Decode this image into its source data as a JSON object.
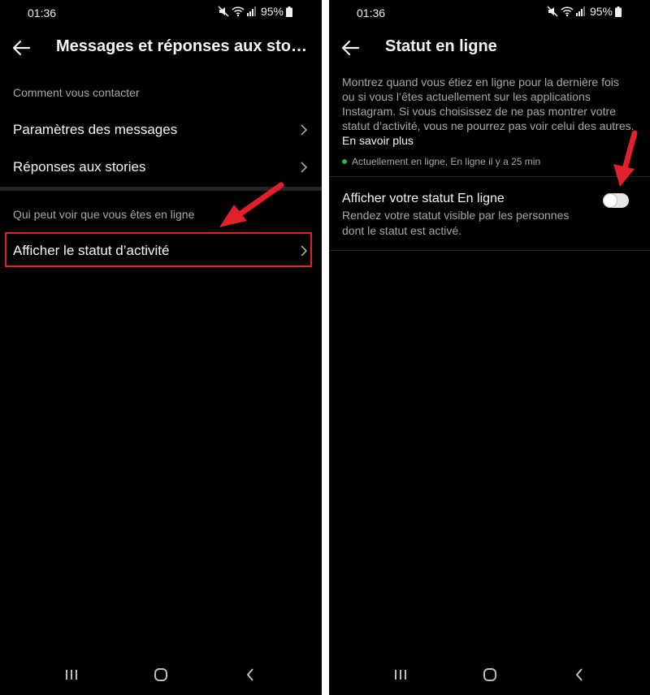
{
  "colors": {
    "background": "#000000",
    "text_primary": "#f5f5f5",
    "text_secondary": "#a8a8a8",
    "divider": "#262626",
    "highlight_red": "#e0202b",
    "online_green": "#2bb24c"
  },
  "left": {
    "status_bar": {
      "time": "01:36",
      "battery": "95%"
    },
    "header": {
      "title": "Messages et réponses aux sto…"
    },
    "section1": {
      "label": "Comment vous contacter",
      "items": [
        {
          "label": "Paramètres des messages",
          "icon": "chevron-right-icon"
        },
        {
          "label": "Réponses aux stories",
          "icon": "chevron-right-icon"
        }
      ]
    },
    "section2": {
      "label": "Qui peut voir que vous êtes en ligne",
      "items": [
        {
          "label": "Afficher le statut d’activité",
          "icon": "chevron-right-icon",
          "highlighted": true
        }
      ]
    }
  },
  "right": {
    "status_bar": {
      "time": "01:36",
      "battery": "95%"
    },
    "header": {
      "title": "Statut en ligne"
    },
    "description": "Montrez quand vous étiez en ligne pour la dernière fois ou si vous l’êtes actuellement sur les applications Instagram. Si vous choisissez de ne pas montrer votre statut d’activité, vous ne pourrez pas voir celui des autres.",
    "learn_more": "En savoir plus",
    "online_status": "Actuellement en ligne, En ligne il y a 25 min",
    "toggle_row": {
      "title": "Afficher votre statut En ligne",
      "subtitle": "Rendez votre statut visible par les personnes dont le statut est activé.",
      "enabled": false
    }
  },
  "nav_bar": {
    "icons": [
      "recent-apps-icon",
      "home-icon",
      "back-icon"
    ]
  }
}
